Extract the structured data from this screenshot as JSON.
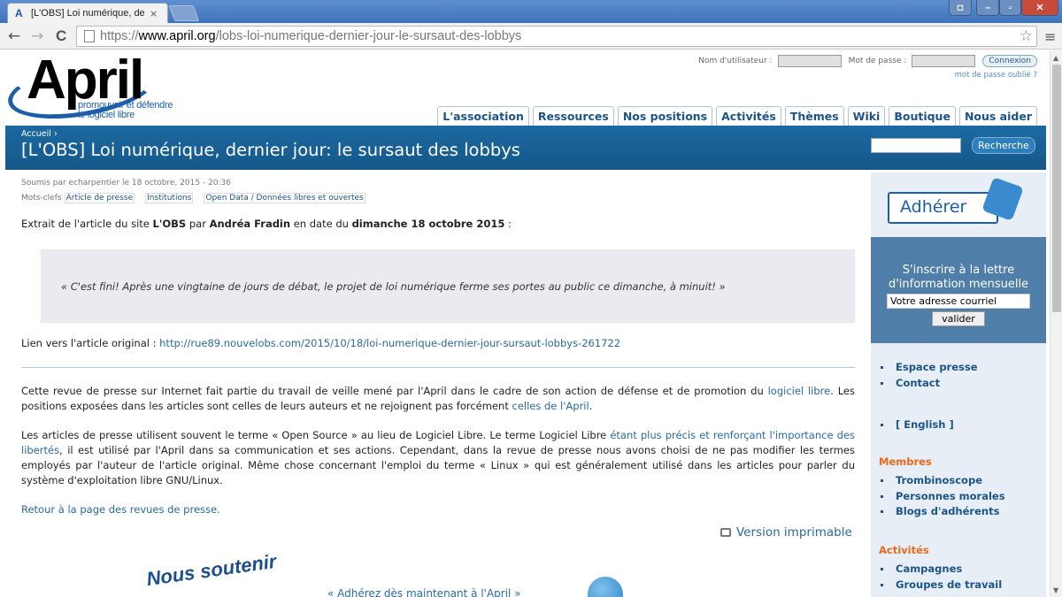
{
  "browser": {
    "tab_title": "[L'OBS] Loi numérique, de",
    "tab_close": "×",
    "favicon_glyph": "A",
    "url_scheme": "https://",
    "url_host": "www.april.org",
    "url_path": "/lobs-loi-numerique-dernier-jour-le-sursaut-des-lobbys",
    "back_glyph": "←",
    "forward_glyph": "→",
    "reload_glyph": "C",
    "star_glyph": "☆",
    "menu_glyph": "≡",
    "win_min": "–",
    "win_max": "▫",
    "win_close": "✕",
    "win_user": "◘"
  },
  "header": {
    "logo_word": "April",
    "logo_tagline_1": "promouvoir et défendre",
    "logo_tagline_2": "le logiciel libre",
    "username_label": "Nom d'utilisateur :",
    "password_label": "Mot de passe :",
    "login_button": "Connexion",
    "forgot_password": "mot de passe oublié ?",
    "nav": [
      "L'association",
      "Ressources",
      "Nos positions",
      "Activités",
      "Thèmes",
      "Wiki",
      "Boutique",
      "Nous aider"
    ]
  },
  "banner": {
    "breadcrumb": "Accueil ›",
    "title": "[L'OBS] Loi numérique, dernier jour: le sursaut des lobbys",
    "search_button": "Recherche"
  },
  "article": {
    "submitted": "Soumis par echarpentier le 18 octobre, 2015 - 20:36",
    "tags_label": "Mots-clefs",
    "tags": [
      "Article de presse",
      "Institutions",
      "Open Data / Données libres et ouvertes"
    ],
    "intro_prefix": "Extrait de l'article du site ",
    "intro_source": "L'OBS",
    "intro_by": " par ",
    "intro_author": "Andréa Fradin",
    "intro_date_prefix": " en date du ",
    "intro_date": "dimanche 18 octobre 2015",
    "intro_suffix": " :",
    "quote": "« C'est fini! Après une vingtaine de jours de débat, le projet de loi numérique ferme ses portes au public ce dimanche, à minuit! »",
    "orig_label": "Lien vers l'article original : ",
    "orig_url": "http://rue89.nouvelobs.com/2015/10/18/loi-numerique-dernier-jour-sursaut-lobbys-261722",
    "para1_a": "Cette revue de presse sur Internet fait partie du travail de veille mené par l'April dans le cadre de son action de défense et de promotion du ",
    "para1_link1": "logiciel libre",
    "para1_b": ". Les positions exposées dans les articles sont celles de leurs auteurs et ne rejoignent pas forcément ",
    "para1_link2": "celles de l'April",
    "para1_c": ".",
    "para2_a": "Les articles de presse utilisent souvent le terme « Open Source » au lieu de Logiciel Libre. Le terme Logiciel Libre ",
    "para2_link": "étant plus précis et renforçant l'importance des libertés",
    "para2_b": ", il est utilisé par l'April dans sa communication et ses actions. Cependant, dans la revue de presse nous avons choisi de ne pas modifier les termes employés par l'auteur de l'article original. Même chose concernant l'emploi du terme « Linux » qui est généralement utilisé dans les articles pour parler du système d'exploitation libre GNU/Linux.",
    "back_link": "Retour à la page des revues de presse.",
    "print_link": "Version imprimable",
    "support_heading": "Nous soutenir",
    "support_text": "« Adhérez dès maintenant à l'April »"
  },
  "sidebar": {
    "adherer": "Adhérer",
    "newsletter_text": "S'inscrire à la lettre d'information mensuelle",
    "email_placeholder": "Votre adresse courriel",
    "validate": "valider",
    "press_links": [
      "Espace presse",
      "Contact"
    ],
    "english": "[ English ]",
    "members_heading": "Membres",
    "members_links": [
      "Trombinoscope",
      "Personnes morales",
      "Blogs d'adhérents"
    ],
    "activities_heading": "Activités",
    "activities_links": [
      "Campagnes",
      "Groupes de travail"
    ]
  },
  "colors": {
    "brand_blue": "#1c5fa8",
    "banner_blue": "#1c6aa3",
    "link_blue": "#2a6aa0",
    "accent_orange": "#e86a1a",
    "sidebar_bg": "#e8eef5"
  }
}
